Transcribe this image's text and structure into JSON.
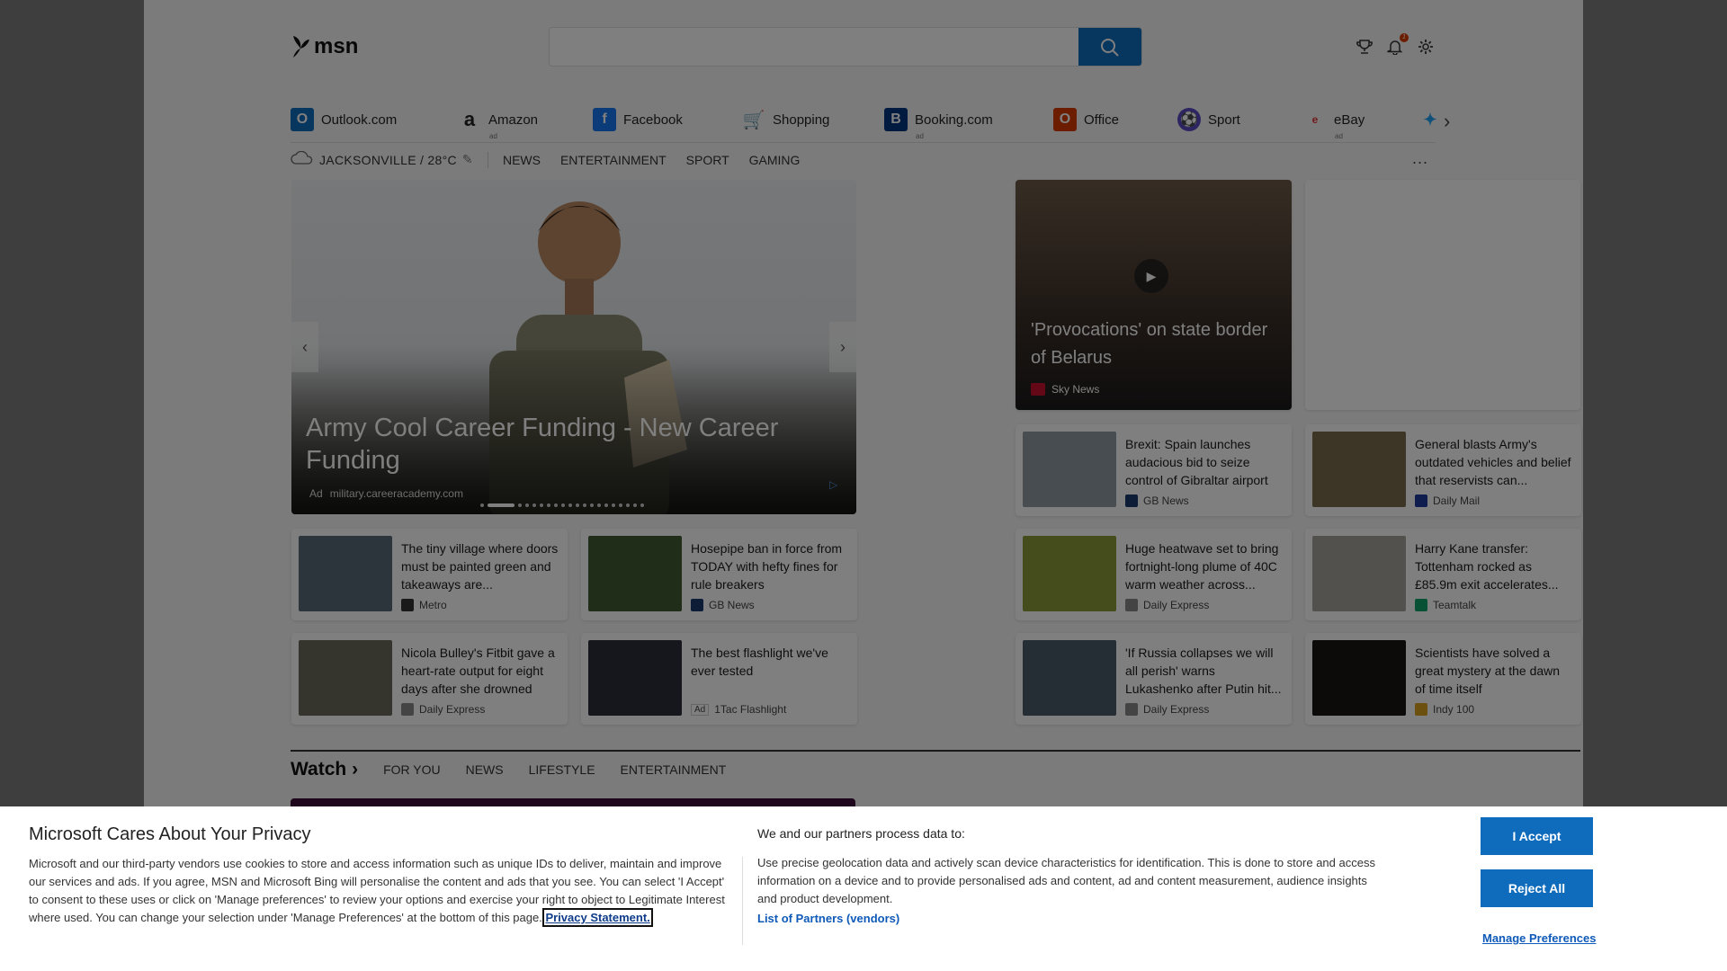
{
  "header": {
    "logo_text": "msn",
    "search": {
      "placeholder": "",
      "value": ""
    },
    "notification_count": "1"
  },
  "quicklinks": [
    {
      "label": "Outlook.com",
      "icon": "outlook-icon",
      "color": "#0f6cbd",
      "ad": false
    },
    {
      "label": "Amazon",
      "icon": "amazon-icon",
      "color": "#222222",
      "ad": true
    },
    {
      "label": "Facebook",
      "icon": "facebook-icon",
      "color": "#1877f2",
      "ad": false
    },
    {
      "label": "Shopping",
      "icon": "shopping-cart-icon",
      "color": "#0f6cbd",
      "ad": false
    },
    {
      "label": "Booking.com",
      "icon": "booking-icon",
      "color": "#003580",
      "ad": true
    },
    {
      "label": "Office",
      "icon": "office-icon",
      "color": "#d83b01",
      "ad": false
    },
    {
      "label": "Sport",
      "icon": "sport-icon",
      "color": "#5b4bc4",
      "ad": false
    },
    {
      "label": "eBay",
      "icon": "ebay-icon",
      "color": "#e53238",
      "ad": true
    }
  ],
  "ad_tag": "ad",
  "subnav": {
    "weather": "JACKSONVILLE / 28°C",
    "items": [
      "NEWS",
      "ENTERTAINMENT",
      "SPORT",
      "GAMING"
    ],
    "more": "..."
  },
  "hero": {
    "title": "Army Cool Career Funding - New Career Funding",
    "ad_label": "Ad",
    "source": "military.careeracademy.com"
  },
  "feature": {
    "title": "'Provocations' on state border of Belarus",
    "source": "Sky News"
  },
  "cards": [
    {
      "title": "Brexit: Spain launches audacious bid to seize control of Gibraltar airport",
      "source": "GB News",
      "thumb_color": "#8e9aa3",
      "source_color": "#1d3a6e"
    },
    {
      "title": "General blasts Army's outdated vehicles and belief that reservists can...",
      "source": "Daily Mail",
      "thumb_color": "#7a6a4a",
      "source_color": "#1d3a9a"
    },
    {
      "title": "The tiny village where doors must be painted green and takeaways are...",
      "source": "Metro",
      "thumb_color": "#5b6b78",
      "source_color": "#333333"
    },
    {
      "title": "Hosepipe ban in force from TODAY with hefty fines for rule breakers",
      "source": "GB News",
      "thumb_color": "#3e5a32",
      "source_color": "#1d3a6e"
    },
    {
      "title": "Huge heatwave set to bring fortnight-long plume of 40C warm weather across...",
      "source": "Daily Express",
      "thumb_color": "#8a9a3a",
      "source_color": "#888888"
    },
    {
      "title": "Harry Kane transfer: Tottenham rocked as £85.9m exit accelerates...",
      "source": "Teamtalk",
      "thumb_color": "#a7a29a",
      "source_color": "#12a36a"
    },
    {
      "title": "Nicola Bulley's Fitbit gave a heart-rate output for eight days after she drowned",
      "source": "Daily Express",
      "thumb_color": "#6b6b5b",
      "source_color": "#888888"
    },
    {
      "title": "The best flashlight we've ever tested",
      "source": "1Tac Flashlight",
      "ad_label": "Ad",
      "thumb_color": "#2a2f38",
      "source_color": "#ffffff"
    },
    {
      "title": "'If Russia collapses we will all perish' warns Lukashenko after Putin hit...",
      "source": "Daily Express",
      "thumb_color": "#4a5a6a",
      "source_color": "#888888"
    },
    {
      "title": "Scientists have solved a great mystery at the dawn of time itself",
      "source": "Indy 100",
      "thumb_color": "#1a1414",
      "source_color": "#d8a020"
    }
  ],
  "watch": {
    "title": "Watch",
    "tabs": [
      "FOR YOU",
      "NEWS",
      "LIFESTYLE",
      "ENTERTAINMENT"
    ]
  },
  "privacy": {
    "title": "Microsoft Cares About Your Privacy",
    "text": "Microsoft and our third-party vendors use cookies to store and access information such as unique IDs to deliver, maintain and improve our services and ads. If you agree, MSN and Microsoft Bing will personalise the content and ads that you see. You can select 'I Accept' to consent to these uses or click on 'Manage preferences' to review your options and exercise your right to object to Legitimate Interest where used.  You can change your selection under 'Manage Preferences' at the bottom of this page. ",
    "privacy_link": "Privacy Statement.",
    "subtitle": "We and our partners process data to:",
    "description": "Use precise geolocation data and actively scan device characteristics for identification. This is done to store and access information on a device and to provide personalised ads and content, ad and content measurement, audience insights and product development.",
    "partners_link": "List of Partners (vendors)",
    "accept": "I Accept",
    "reject": "Reject All",
    "manage": "Manage Preferences"
  },
  "colors": {
    "accent": "#0f6cbd",
    "banner_bg": "#ffffff",
    "overlay": "rgba(0,0,0,0.5)"
  }
}
